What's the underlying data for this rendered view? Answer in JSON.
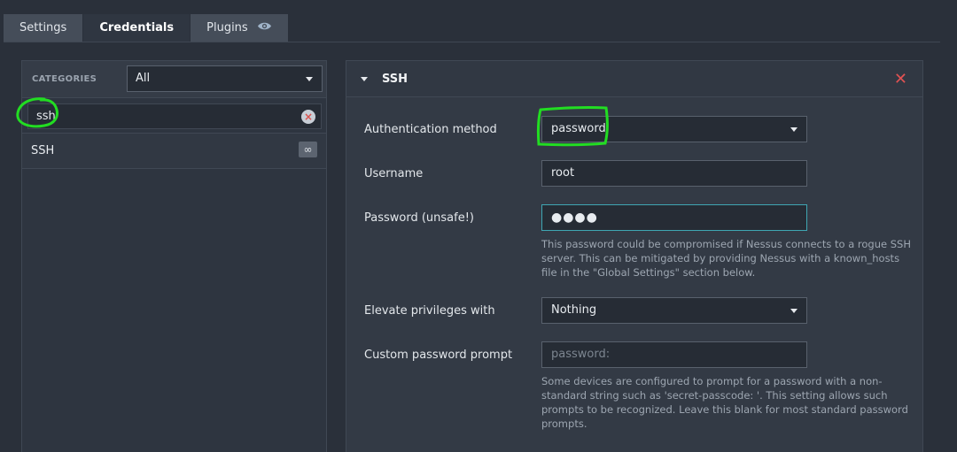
{
  "tabs": [
    {
      "label": "Settings",
      "active": false
    },
    {
      "label": "Credentials",
      "active": true
    },
    {
      "label": "Plugins",
      "active": false,
      "icon": "eye-icon"
    }
  ],
  "sidebar": {
    "categories_label": "CATEGORIES",
    "category_select_value": "All",
    "search_value": "ssh",
    "items": [
      {
        "label": "SSH",
        "badge": "∞"
      }
    ]
  },
  "panel": {
    "title": "SSH",
    "auth_label": "Authentication method",
    "auth_value": "password",
    "username_label": "Username",
    "username_value": "root",
    "password_label": "Password (unsafe!)",
    "password_value": "●●●●",
    "password_help": "This password could be compromised if Nessus connects to a rogue SSH server. This can be mitigated by providing Nessus with a known_hosts file in the \"Global Settings\" section below.",
    "elevate_label": "Elevate privileges with",
    "elevate_value": "Nothing",
    "prompt_label": "Custom password prompt",
    "prompt_placeholder": "password:",
    "prompt_help": "Some devices are configured to prompt for a password with a non-standard string such as 'secret-passcode: '. This setting allows such prompts to be recognized. Leave this blank for most standard password prompts."
  },
  "colors": {
    "annotation": "#22dd22",
    "close": "#e05252",
    "focus_border": "#3fa6b3"
  }
}
